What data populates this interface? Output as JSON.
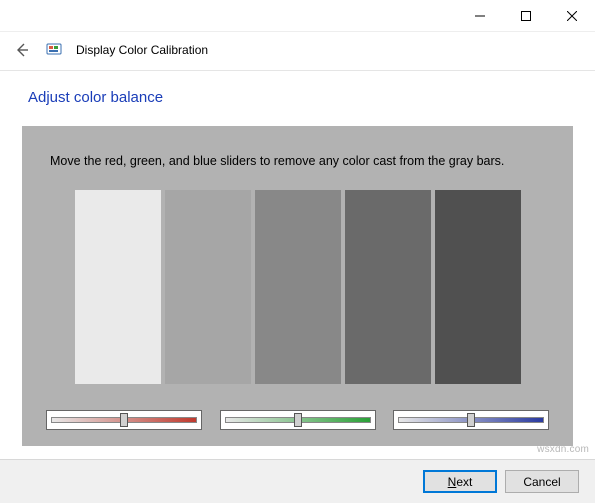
{
  "window": {
    "title": "Display Color Calibration"
  },
  "page": {
    "heading": "Adjust color balance",
    "instruction": "Move the red, green, and blue sliders to remove any color cast from the gray bars."
  },
  "bars": {
    "colors": [
      "#eaeaea",
      "#a6a6a6",
      "#888888",
      "#6a6a6a",
      "#505050"
    ]
  },
  "sliders": {
    "red": {
      "gradient_end": "#c03a2e",
      "value": 50
    },
    "green": {
      "gradient_end": "#2aa037",
      "value": 50
    },
    "blue": {
      "gradient_end": "#2a3aa0",
      "value": 50
    }
  },
  "buttons": {
    "next_prefix": "N",
    "next_rest": "ext",
    "cancel": "Cancel"
  },
  "watermark": "wsxdn.com"
}
